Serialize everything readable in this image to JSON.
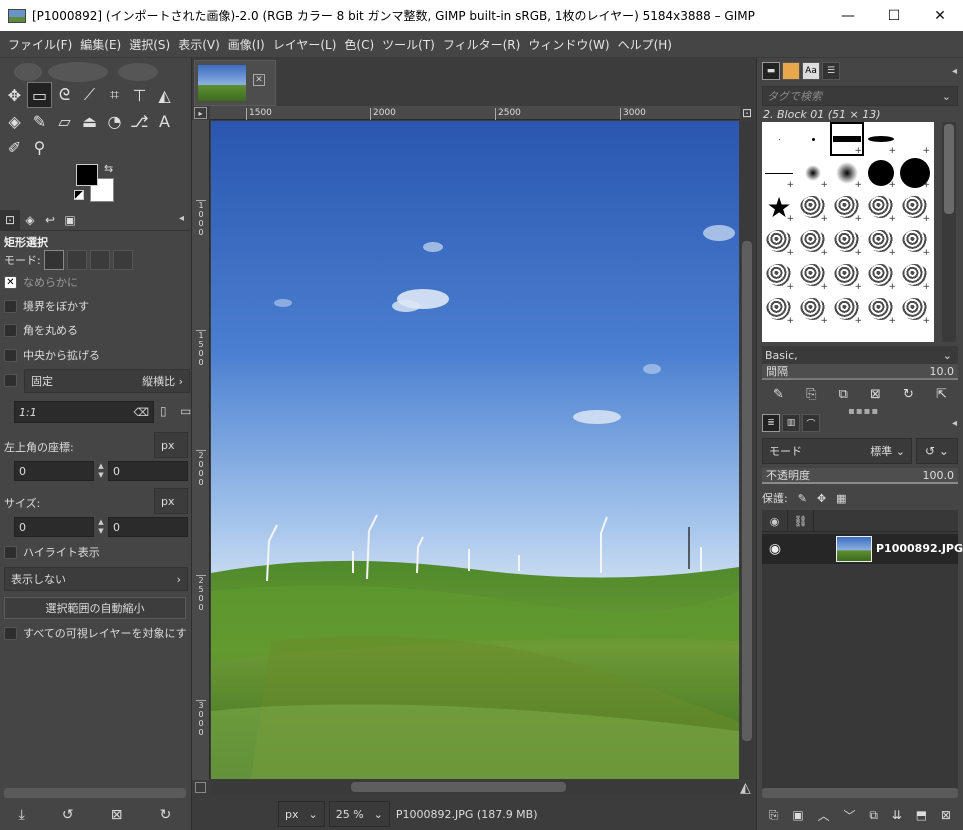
{
  "window": {
    "title": "[P1000892] (インポートされた画像)-2.0 (RGB カラー 8 bit ガンマ整数, GIMP built-in sRGB, 1枚のレイヤー) 5184x3888 – GIMP",
    "minimize": "—",
    "maximize": "☐",
    "close": "✕"
  },
  "menubar": [
    "ファイル(F)",
    "編集(E)",
    "選択(S)",
    "表示(V)",
    "画像(I)",
    "レイヤー(L)",
    "色(C)",
    "ツール(T)",
    "フィルター(R)",
    "ウィンドウ(W)",
    "ヘルプ(H)"
  ],
  "toolbox": {
    "tools": [
      {
        "icon": "move-icon",
        "glyph": "✥"
      },
      {
        "icon": "rect-select-icon",
        "glyph": "▭",
        "active": true
      },
      {
        "icon": "lasso-icon",
        "glyph": "ᘓ"
      },
      {
        "icon": "fuzzy-select-icon",
        "glyph": "⟋"
      },
      {
        "icon": "crop-icon",
        "glyph": "⌗"
      },
      {
        "icon": "transform-icon",
        "glyph": "⊤"
      },
      {
        "icon": "warp-icon",
        "glyph": "◭"
      },
      {
        "icon": "bucket-fill-icon",
        "glyph": "◈"
      },
      {
        "icon": "paintbrush-icon",
        "glyph": "✎"
      },
      {
        "icon": "eraser-icon",
        "glyph": "▱"
      },
      {
        "icon": "clone-icon",
        "glyph": "⏏"
      },
      {
        "icon": "smudge-icon",
        "glyph": "◔"
      },
      {
        "icon": "paths-icon",
        "glyph": "⎇"
      },
      {
        "icon": "text-icon",
        "glyph": "A"
      },
      {
        "icon": "color-picker-icon",
        "glyph": "✐"
      },
      {
        "icon": "zoom-icon",
        "glyph": "⚲"
      }
    ],
    "colors": {
      "foreground": "#000000",
      "background": "#ffffff"
    }
  },
  "tool_options": {
    "title": "矩形選択",
    "mode_label": "モード:",
    "antialias": {
      "label": "なめらかに",
      "checked": true
    },
    "feather": {
      "label": "境界をぼかす",
      "checked": false
    },
    "rounded": {
      "label": "角を丸める",
      "checked": false
    },
    "expand_center": {
      "label": "中央から拡げる",
      "checked": false
    },
    "fixed": {
      "label": "固定",
      "option": "縦横比",
      "checked": false
    },
    "ratio_value": "1:1",
    "position_label": "左上角の座標:",
    "position_unit": "px",
    "position_x": "0",
    "position_y": "0",
    "size_label": "サイズ:",
    "size_unit": "px",
    "size_w": "0",
    "size_h": "0",
    "highlight": {
      "label": "ハイライト表示",
      "checked": false
    },
    "guides": "表示しない",
    "autoshrink_button": "選択範囲の自動縮小",
    "shrink_merged": {
      "label": "すべての可視レイヤーを対象にす",
      "checked": false
    }
  },
  "canvas": {
    "ruler_h": [
      "1500",
      "2000",
      "2500",
      "3000"
    ],
    "ruler_v": [
      "1000",
      "1500",
      "2000",
      "2500",
      "3000"
    ],
    "unit": "px",
    "zoom": "25 %",
    "status": "P1000892.JPG (187.9 MB)"
  },
  "brushes": {
    "tag_placeholder": "タグで検索",
    "selected_name": "2. Block 01 (51 × 13)",
    "set": "Basic,",
    "spacing_label": "間隔",
    "spacing_value": "10.0"
  },
  "layers": {
    "mode_label": "モード",
    "mode_value": "標準",
    "opacity_label": "不透明度",
    "opacity_value": "100.0",
    "lock_label": "保護:",
    "layer_name": "P1000892.JPG"
  }
}
